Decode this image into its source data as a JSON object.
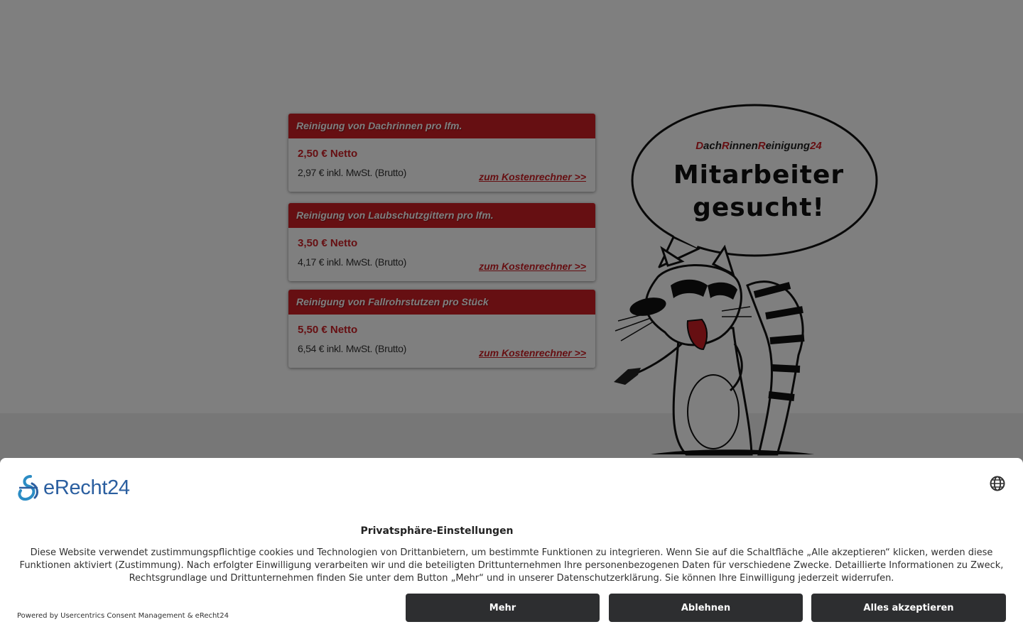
{
  "prices": [
    {
      "title": "Reinigung von Dachrinnen pro lfm.",
      "net": "2,50 € Netto",
      "gross": "2,97 € inkl. MwSt. (Brutto)",
      "link": "zum Kostenrechner >>"
    },
    {
      "title": "Reinigung von Laubschutzgittern pro lfm.",
      "net": "3,50 € Netto",
      "gross": "4,17 € inkl. MwSt. (Brutto)",
      "link": "zum Kostenrechner >>"
    },
    {
      "title": "Reinigung von Fallrohrstutzen pro Stück",
      "net": "5,50 € Netto",
      "gross": "6,54 € inkl. MwSt. (Brutto)",
      "link": "zum Kostenrechner >>"
    }
  ],
  "bubble": {
    "brand_parts": [
      "D",
      "ach",
      "R",
      "innen",
      "R",
      "einigung",
      "24"
    ],
    "line1": "Mitarbeiter",
    "line2": "gesucht!"
  },
  "consent": {
    "logo_text": "eRecht24",
    "title": "Privatsphäre-Einstellungen",
    "text": "Diese Website verwendet zustimmungspflichtige cookies und Technologien von Drittanbietern, um bestimmte Funktionen zu integrieren. Wenn Sie auf die Schaltfläche „Alle akzeptieren“ klicken, werden diese Funktionen aktiviert (Zustimmung). Nach erfolgter Einwilligung verarbeiten wir und die beteiligten Drittunternehmen Ihre personenbezogenen Daten für verschiedene Zwecke. Detaillierte Informationen zu Zweck, Rechtsgrundlage und Drittunternehmen finden Sie unter dem Button „Mehr“ und in unserer Datenschutzerklärung. Sie können Ihre Einwilligung jederzeit widerrufen.",
    "powered_by": "Powered by Usercentrics Consent Management & eRecht24",
    "buttons": {
      "more": "Mehr",
      "decline": "Ablehnen",
      "accept": "Alles akzeptieren"
    }
  },
  "colors": {
    "brand_red": "#cc1e24",
    "button_dark": "#2d2e30",
    "logo_blue": "#2b5fa0",
    "overlay": "rgba(0,0,0,0.5)"
  },
  "icons": {
    "language": "globe-icon",
    "logo": "erecht24-logo-icon"
  }
}
